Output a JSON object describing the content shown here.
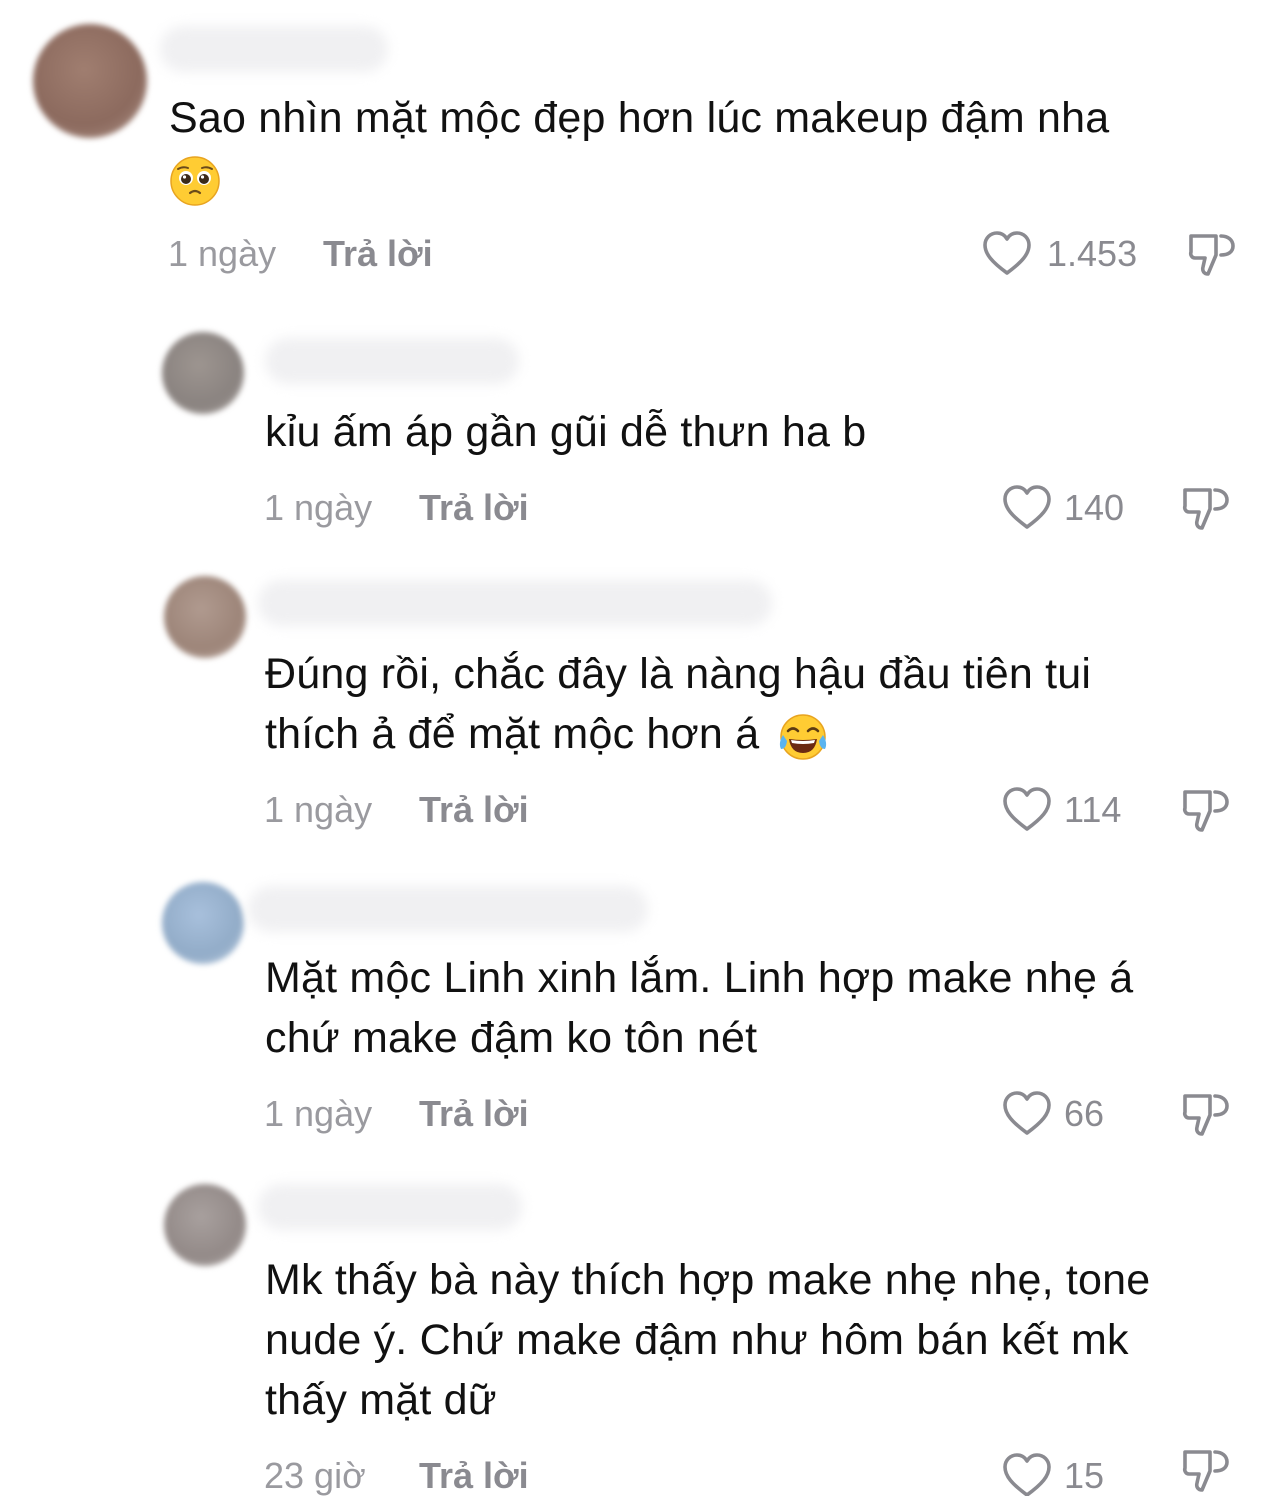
{
  "comments": [
    {
      "lines": [
        "Sao nhìn mặt mộc đẹp hơn lúc makeup đậm nha"
      ],
      "emoji": "pleading-face-emoji",
      "time": "1 ngày",
      "reply_label": "Trả lời",
      "likes": "1.453"
    },
    {
      "lines": [
        "kỉu ấm áp gần gũi dễ thưn ha b"
      ],
      "time": "1 ngày",
      "reply_label": "Trả lời",
      "likes": "140"
    },
    {
      "lines": [
        "Đúng rồi, chắc đây là nàng hậu đầu tiên tui",
        "thích ả để mặt mộc hơn á"
      ],
      "emoji": "tears-of-joy-emoji",
      "time": "1 ngày",
      "reply_label": "Trả lời",
      "likes": "114"
    },
    {
      "lines": [
        "Mặt mộc Linh xinh lắm. Linh hợp make nhẹ á",
        "chứ make đậm ko tôn nét"
      ],
      "time": "1 ngày",
      "reply_label": "Trả lời",
      "likes": "66"
    },
    {
      "lines": [
        "Mk thấy bà này thích hợp make nhẹ nhẹ, tone",
        "nude ý. Chứ make đậm như hôm bán kết mk",
        "thấy mặt dữ"
      ],
      "time": "23 giờ",
      "reply_label": "Trả lời",
      "likes": "15"
    }
  ],
  "colors": {
    "text": "#111111",
    "meta": "#9a9a9f",
    "icon": "#8a8a90"
  }
}
